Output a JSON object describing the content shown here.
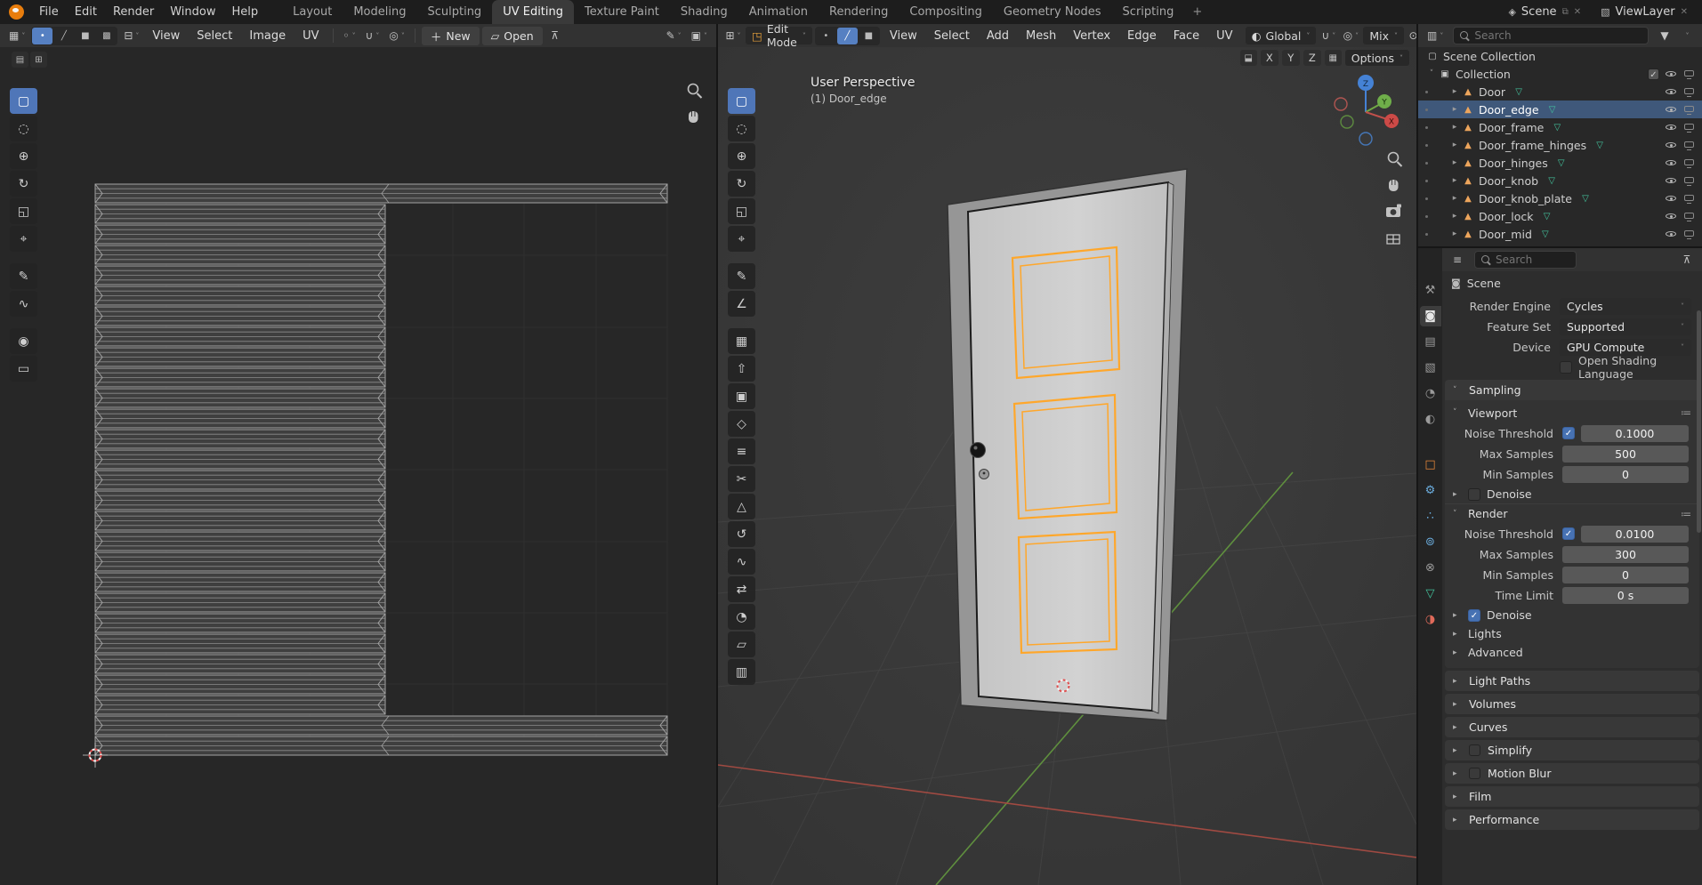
{
  "topbar": {
    "menus": [
      "File",
      "Edit",
      "Render",
      "Window",
      "Help"
    ],
    "tabs": [
      "Layout",
      "Modeling",
      "Sculpting",
      "UV Editing",
      "Texture Paint",
      "Shading",
      "Animation",
      "Rendering",
      "Compositing",
      "Geometry Nodes",
      "Scripting"
    ],
    "active_tab": "UV Editing",
    "add_tab_label": "+",
    "scene": {
      "label": "Scene"
    },
    "view_layer": {
      "label": "ViewLayer"
    }
  },
  "uv_editor": {
    "menus": [
      "View",
      "Select",
      "Image",
      "UV"
    ],
    "new_button": "New",
    "open_button": "Open"
  },
  "viewport": {
    "mode": "Edit Mode",
    "menus": [
      "View",
      "Select",
      "Add",
      "Mesh",
      "Vertex",
      "Edge",
      "Face",
      "UV"
    ],
    "transform_orientation": "Global",
    "mix_label": "Mix",
    "mirror_axes": [
      "X",
      "Y",
      "Z"
    ],
    "options_label": "Options",
    "overlay": {
      "line1": "User Perspective",
      "line2": "(1) Door_edge"
    },
    "gizmo": {
      "x": "X",
      "y": "Y",
      "z": "Z"
    }
  },
  "outliner": {
    "search_placeholder": "Search",
    "scene_collection": "Scene Collection",
    "collection": "Collection",
    "objects": [
      "Door",
      "Door_edge",
      "Door_frame",
      "Door_frame_hinges",
      "Door_hinges",
      "Door_knob",
      "Door_knob_plate",
      "Door_lock",
      "Door_mid"
    ],
    "selected_object": "Door_edge"
  },
  "properties": {
    "search_placeholder": "Search",
    "breadcrumb": "Scene",
    "fields": {
      "render_engine": {
        "label": "Render Engine",
        "value": "Cycles"
      },
      "feature_set": {
        "label": "Feature Set",
        "value": "Supported"
      },
      "device": {
        "label": "Device",
        "value": "GPU Compute"
      },
      "osl": {
        "label": "Open Shading Language",
        "checked": false
      }
    },
    "sampling": {
      "title": "Sampling",
      "viewport": {
        "title": "Viewport",
        "noise_threshold": {
          "label": "Noise Threshold",
          "value": "0.1000",
          "checked": true
        },
        "max_samples": {
          "label": "Max Samples",
          "value": "500"
        },
        "min_samples": {
          "label": "Min Samples",
          "value": "0"
        },
        "denoise": {
          "label": "Denoise",
          "checked": false
        }
      },
      "render": {
        "title": "Render",
        "noise_threshold": {
          "label": "Noise Threshold",
          "value": "0.0100",
          "checked": true
        },
        "max_samples": {
          "label": "Max Samples",
          "value": "300"
        },
        "min_samples": {
          "label": "Min Samples",
          "value": "0"
        },
        "time_limit": {
          "label": "Time Limit",
          "value": "0 s"
        },
        "denoise": {
          "label": "Denoise",
          "checked": true
        }
      },
      "lights": "Lights",
      "advanced": "Advanced"
    },
    "sections": [
      "Light Paths",
      "Volumes",
      "Curves",
      "Simplify",
      "Motion Blur",
      "Film",
      "Performance"
    ]
  },
  "icons": {
    "uv_tools": [
      "▢",
      "◌",
      "⊕",
      "↻",
      "◱",
      "⌖",
      "✎",
      "∿",
      "◉",
      "▭"
    ],
    "vp_tools": [
      "▢",
      "◌",
      "⊕",
      "↻",
      "◱",
      "⌖",
      "✎",
      "∠",
      "▦",
      "⇧",
      "▣",
      "◇",
      "≡",
      "✂",
      "△",
      "↺",
      "∿",
      "⇄",
      "◔",
      "▱",
      "▥"
    ],
    "prop_tabs": [
      "⚒",
      "◙",
      "▤",
      "▧",
      "◔",
      "◐",
      "□",
      "⚙",
      "∴",
      "⊚",
      "⊗",
      "▽",
      "◑"
    ],
    "uv_select_modes": [
      "•",
      "╱",
      "■",
      "▩"
    ],
    "vp_select_modes": [
      "•",
      "╱",
      "■"
    ]
  }
}
